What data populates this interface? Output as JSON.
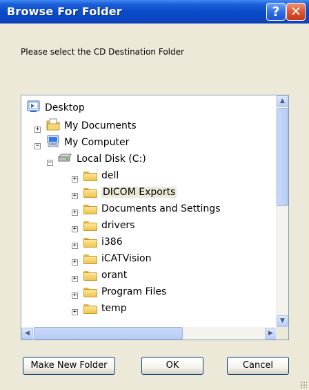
{
  "window": {
    "title": "Browse For Folder",
    "help_glyph": "?",
    "close_glyph": "✕"
  },
  "prompt": "Please select the CD Destination Folder",
  "tree": {
    "items": [
      {
        "label": "Desktop",
        "icon": "desktop-icon"
      },
      {
        "label": "My Documents",
        "icon": "my-documents-icon",
        "expander": "+"
      },
      {
        "label": "My Computer",
        "icon": "my-computer-icon",
        "expander": "−"
      },
      {
        "label": "Local Disk (C:)",
        "icon": "disk-drive-icon",
        "expander": "−"
      },
      {
        "label": "dell",
        "icon": "folder-icon",
        "expander": "+"
      },
      {
        "label": "DICOM Exports",
        "icon": "folder-icon",
        "expander": "+",
        "selected": true
      },
      {
        "label": "Documents and Settings",
        "icon": "folder-icon",
        "expander": "+"
      },
      {
        "label": "drivers",
        "icon": "folder-icon",
        "expander": "+"
      },
      {
        "label": "i386",
        "icon": "folder-icon",
        "expander": "+"
      },
      {
        "label": "iCATVision",
        "icon": "folder-icon",
        "expander": "+"
      },
      {
        "label": "orant",
        "icon": "folder-icon",
        "expander": "+"
      },
      {
        "label": "Program Files",
        "icon": "folder-icon",
        "expander": "+"
      },
      {
        "label": "temp",
        "icon": "folder-icon",
        "expander": "+"
      }
    ],
    "scroll": {
      "up": "▲",
      "down": "▼",
      "left": "◀",
      "right": "▶"
    }
  },
  "buttons": {
    "new_folder": "Make New Folder",
    "ok": "OK",
    "cancel": "Cancel"
  },
  "colors": {
    "titlebar": "#0A4CC8",
    "dialog_bg": "#ECE9D8",
    "tree_border": "#7F9DB9"
  }
}
